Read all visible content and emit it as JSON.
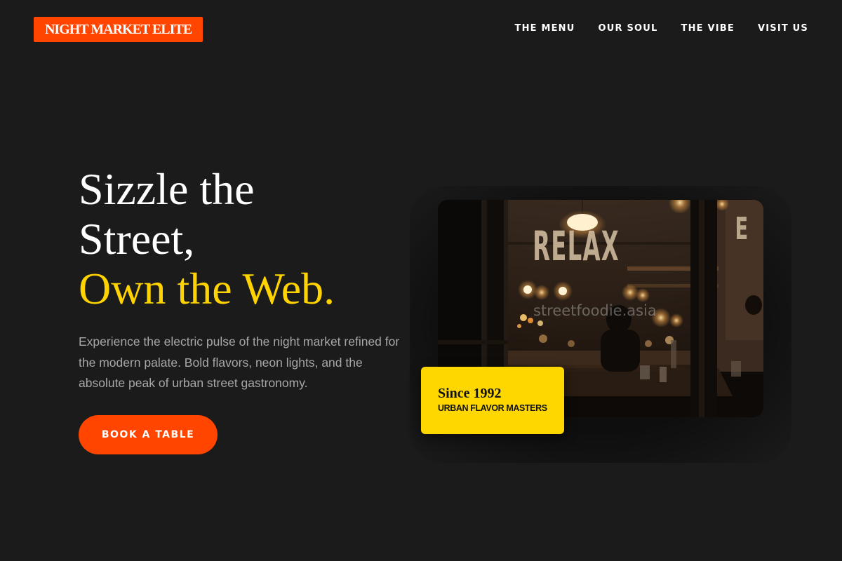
{
  "header": {
    "logo_text": "NIGHT MARKET ELITE",
    "nav": [
      "THE MENU",
      "OUR SOUL",
      "THE VIBE",
      "VISIT US"
    ]
  },
  "hero": {
    "headline_line1": "Sizzle the",
    "headline_line2": "Street,",
    "headline_accent": "Own the Web.",
    "description": "Experience the electric pulse of the night market refined for the modern palate. Bold flavors, neon lights, and the absolute peak of urban street gastronomy.",
    "cta_label": "BOOK A TABLE"
  },
  "photo": {
    "sign_text": "RELAX",
    "watermark": "streetfoodie.asia"
  },
  "badge": {
    "title": "Since 1992",
    "subtitle": "URBAN FLAVOR MASTERS"
  },
  "colors": {
    "background": "#1b1b1b",
    "brand_orange": "#ff4500",
    "accent_yellow": "#ffd300",
    "text_muted": "#a7a7a7"
  }
}
